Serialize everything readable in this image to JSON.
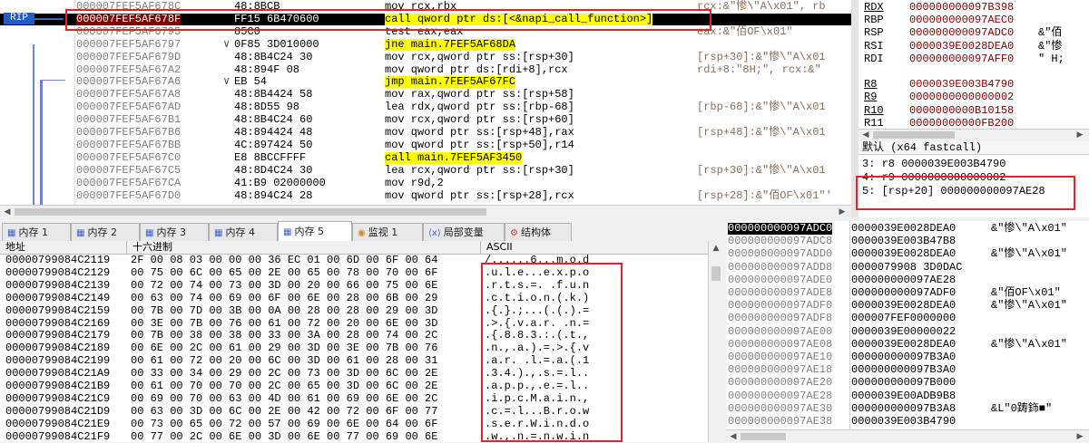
{
  "rip_label": "RIP",
  "disasm": {
    "rows": [
      {
        "addr": "000007FEF5AF678C",
        "bytes": "48:8BCB",
        "asm": "mov rcx,rbx",
        "cmt": "rcx:&\"惨\\\"A\\x01\", rb"
      },
      {
        "addr": "000007FEF5AF678F",
        "bytes": "FF15 6B470600",
        "asm": "call qword ptr ds:[<&napi_call_function>]",
        "cmt": "",
        "rip": true
      },
      {
        "addr": "000007FEF5AF6795",
        "bytes": "85C0",
        "asm": "test eax,eax",
        "cmt": "eax:&\"佰OF\\x01\""
      },
      {
        "addr": "000007FEF5AF6797",
        "bytes": "0F85 3D010000",
        "asm": "jne main.7FEF5AF68DA",
        "cmt": "",
        "jump": true,
        "mark": "∨"
      },
      {
        "addr": "000007FEF5AF679D",
        "bytes": "48:8B4C24 30",
        "asm": "mov rcx,qword ptr ss:[rsp+30]",
        "cmt": "[rsp+30]:&\"惨\\\"A\\x01"
      },
      {
        "addr": "000007FEF5AF67A2",
        "bytes": "48:894F 08",
        "asm": "mov qword ptr ds:[rdi+8],rcx",
        "cmt": "rdi+8:\"8H;\", rcx:&\""
      },
      {
        "addr": "000007FEF5AF67A6",
        "bytes": "EB 54",
        "asm": "jmp main.7FEF5AF67FC",
        "cmt": "",
        "jump": true,
        "mark": "∨"
      },
      {
        "addr": "000007FEF5AF67A8",
        "bytes": "48:8B4424 58",
        "asm": "mov rax,qword ptr ss:[rsp+58]",
        "cmt": ""
      },
      {
        "addr": "000007FEF5AF67AD",
        "bytes": "48:8D55 98",
        "asm": "lea rdx,qword ptr ss:[rbp-68]",
        "cmt": "[rbp-68]:&\"惨\\\"A\\x01"
      },
      {
        "addr": "000007FEF5AF67B1",
        "bytes": "48:8B4C24 60",
        "asm": "mov rcx,qword ptr ss:[rsp+60]",
        "cmt": ""
      },
      {
        "addr": "000007FEF5AF67B6",
        "bytes": "48:894424 48",
        "asm": "mov qword ptr ss:[rsp+48],rax",
        "cmt": "[rsp+48]:&\"惨\\\"A\\x01"
      },
      {
        "addr": "000007FEF5AF67BB",
        "bytes": "4C:897424 50",
        "asm": "mov qword ptr ss:[rsp+50],r14",
        "cmt": ""
      },
      {
        "addr": "000007FEF5AF67C0",
        "bytes": "E8 8BCCFFFF",
        "asm": "call main.7FEF5AF3450",
        "cmt": "",
        "call": true
      },
      {
        "addr": "000007FEF5AF67C5",
        "bytes": "48:8D4C24 30",
        "asm": "lea rcx,qword ptr ss:[rsp+30]",
        "cmt": "[rsp+30]:&\"惨\\\"A\\x01"
      },
      {
        "addr": "000007FEF5AF67CA",
        "bytes": "41:B9 02000000",
        "asm": "mov r9d,2",
        "cmt": ""
      },
      {
        "addr": "000007FEF5AF67D0",
        "bytes": "48:894C24 28",
        "asm": "mov qword ptr ss:[rsp+28],rcx",
        "cmt": "[rsp+28]:&\"佰OF\\x01\"'"
      }
    ]
  },
  "registers": [
    {
      "name": "RDX",
      "value": "000000000097B398",
      "comment": "",
      "ul": true
    },
    {
      "name": "RBP",
      "value": "000000000097AEC0",
      "comment": ""
    },
    {
      "name": "RSP",
      "value": "000000000097ADC0",
      "comment": "&\"佰"
    },
    {
      "name": "RSI",
      "value": "0000039E0028DEA0",
      "comment": "&\"惨"
    },
    {
      "name": "RDI",
      "value": "000000000097AFF0",
      "comment": "\" H;"
    },
    {
      "name": "",
      "value": "",
      "comment": ""
    },
    {
      "name": "R8",
      "value": "0000039E003B4790",
      "comment": "",
      "ul": true
    },
    {
      "name": "R9",
      "value": "0000000000000002",
      "comment": "",
      "ul": true
    },
    {
      "name": "R10",
      "value": "0000000000B10158",
      "comment": "",
      "ul": true
    },
    {
      "name": "R11",
      "value": "00000000000FB200",
      "comment": ""
    }
  ],
  "args": {
    "header": "默认 (x64 fastcall)",
    "rows": [
      "3: r8 0000039E003B4790",
      "4: r9 0000000000000002",
      "5: [rsp+20] 000000000097AE28"
    ]
  },
  "tabs": [
    {
      "label": "内存 1",
      "icon": "memory-icon"
    },
    {
      "label": "内存 2",
      "icon": "memory-icon"
    },
    {
      "label": "内存 3",
      "icon": "memory-icon"
    },
    {
      "label": "内存 4",
      "icon": "memory-icon"
    },
    {
      "label": "内存 5",
      "icon": "memory-icon",
      "active": true
    },
    {
      "label": "监视 1",
      "icon": "watch-icon"
    },
    {
      "label": "局部变量",
      "icon": "locals-icon"
    },
    {
      "label": "结构体",
      "icon": "struct-icon"
    }
  ],
  "dump": {
    "col_addr": "地址",
    "col_hex": "十六进制",
    "col_ascii": "ASCII",
    "rows": [
      {
        "addr": "00000799084C2119",
        "hex": "2F 00 08 03 00 00 00 36 EC 01 00 6D 00 6F 00 64",
        "ascii": "/......6...m.o.d"
      },
      {
        "addr": "00000799084C2129",
        "hex": "00 75 00 6C 00 65 00 2E 00 65 00 78 00 70 00 6F",
        "ascii": ".u.l.e...e.x.p.o"
      },
      {
        "addr": "00000799084C2139",
        "hex": "00 72 00 74 00 73 00 3D 00 20 00 66 00 75 00 6E",
        "ascii": ".r.t.s.=. .f.u.n"
      },
      {
        "addr": "00000799084C2149",
        "hex": "00 63 00 74 00 69 00 6F 00 6E 00 28 00 6B 00 29",
        "ascii": ".c.t.i.o.n.(.k.)"
      },
      {
        "addr": "00000799084C2159",
        "hex": "00 7B 00 7D 00 3B 00 0A 00 28 00 28 00 29 00 3D",
        "ascii": ".{.}.;...(.(.).="
      },
      {
        "addr": "00000799084C2169",
        "hex": "00 3E 00 7B 00 76 00 61 00 72 00 20 00 6E 00 3D",
        "ascii": ".>.{.v.a.r. .n.="
      },
      {
        "addr": "00000799084C2179",
        "hex": "00 7B 00 38 00 38 00 33 00 3A 00 28 00 74 00 2C",
        "ascii": ".{.8.8.3.:.(.t.,"
      },
      {
        "addr": "00000799084C2189",
        "hex": "00 6E 00 2C 00 61 00 29 00 3D 00 3E 00 7B 00 76",
        "ascii": ".n.,.a.).=.>.{.v"
      },
      {
        "addr": "00000799084C2199",
        "hex": "00 61 00 72 00 20 00 6C 00 3D 00 61 00 28 00 31",
        "ascii": ".a.r. .l.=.a.(.1"
      },
      {
        "addr": "00000799084C21A9",
        "hex": "00 33 00 34 00 29 00 2C 00 73 00 3D 00 6C 00 2E",
        "ascii": ".3.4.).,.s.=.l.."
      },
      {
        "addr": "00000799084C21B9",
        "hex": "00 61 00 70 00 70 00 2C 00 65 00 3D 00 6C 00 2E",
        "ascii": ".a.p.p.,.e.=.l.."
      },
      {
        "addr": "00000799084C21C9",
        "hex": "00 69 00 70 00 63 00 4D 00 61 00 69 00 6E 00 2C",
        "ascii": ".i.p.c.M.a.i.n.,"
      },
      {
        "addr": "00000799084C21D9",
        "hex": "00 63 00 3D 00 6C 00 2E 00 42 00 72 00 6F 00 77",
        "ascii": ".c.=.l...B.r.o.w"
      },
      {
        "addr": "00000799084C21E9",
        "hex": "00 73 00 65 00 72 00 57 00 69 00 6E 00 64 00 6F",
        "ascii": ".s.e.r.W.i.n.d.o"
      },
      {
        "addr": "00000799084C21F9",
        "hex": "00 77 00 2C 00 6E 00 3D 00 6E 00 77 00 69 00 6E",
        "ascii": ".w.,.n.=.n.w.i.n"
      }
    ]
  },
  "stack": {
    "rows": [
      {
        "addr": "000000000097ADC0",
        "value": "0000039E0028DEA0",
        "cmt": "&\"惨\\\"A\\x01\"",
        "cur": true
      },
      {
        "addr": "000000000097ADC8",
        "value": "0000039E003B47B8",
        "cmt": ""
      },
      {
        "addr": "000000000097ADD0",
        "value": "0000039E0028DEA0",
        "cmt": "&\"惨\\\"A\\x01\""
      },
      {
        "addr": "000000000097ADD8",
        "value": "0000079908 3D0DAC",
        "cmt": ""
      },
      {
        "addr": "000000000097ADE0",
        "value": "000000000097AE28",
        "cmt": ""
      },
      {
        "addr": "000000000097ADE8",
        "value": "000000000097ADF0",
        "cmt": "&\"佰OF\\x01\""
      },
      {
        "addr": "000000000097ADF0",
        "value": "0000039E0028DEA0",
        "cmt": "&\"惨\\\"A\\x01\""
      },
      {
        "addr": "000000000097ADF8",
        "value": "000007FEF0000000",
        "cmt": ""
      },
      {
        "addr": "000000000097AE00",
        "value": "0000039E00000022",
        "cmt": ""
      },
      {
        "addr": "000000000097AE08",
        "value": "0000039E0028DEA0",
        "cmt": "&\"惨\\\"A\\x01\""
      },
      {
        "addr": "000000000097AE10",
        "value": "000000000097B3A0",
        "cmt": ""
      },
      {
        "addr": "000000000097AE18",
        "value": "000000000097B3A0",
        "cmt": ""
      },
      {
        "addr": "000000000097AE20",
        "value": "000000000097B000",
        "cmt": ""
      },
      {
        "addr": "000000000097AE28",
        "value": "0000039E00ADB9B8",
        "cmt": ""
      },
      {
        "addr": "000000000097AE30",
        "value": "000000000097B3A8",
        "cmt": "&L\"0踌鉓■\""
      },
      {
        "addr": "000000000097AE38",
        "value": "0000039E003B4790",
        "cmt": ""
      }
    ]
  }
}
